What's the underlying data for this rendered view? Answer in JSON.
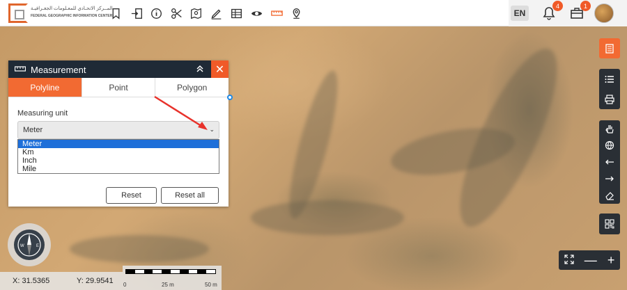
{
  "header": {
    "logo_arabic": "المــركز الاتحـادي للمعـلومات الجغـرافيـة",
    "logo_english": "FEDERAL GEOGRAPHIC INFORMATION CENTER",
    "language": "EN",
    "notifications_count": "4",
    "inbox_count": "1"
  },
  "measurement": {
    "title": "Measurement",
    "tabs": [
      "Polyline",
      "Point",
      "Polygon"
    ],
    "active_tab": "Polyline",
    "unit_label": "Measuring unit",
    "unit_selected": "Meter",
    "unit_options": [
      "Meter",
      "Km",
      "Inch",
      "Mile"
    ],
    "reset_label": "Reset",
    "reset_all_label": "Reset all",
    "close_symbol": "✕"
  },
  "status": {
    "x": "X: 31.5365",
    "y": "Y: 29.9541",
    "scale_ticks": [
      "0",
      "25 m",
      "50 m"
    ]
  },
  "colors": {
    "accent": "#f26a32",
    "header_dark": "#1f2a36",
    "selection": "#1e6fd9"
  }
}
